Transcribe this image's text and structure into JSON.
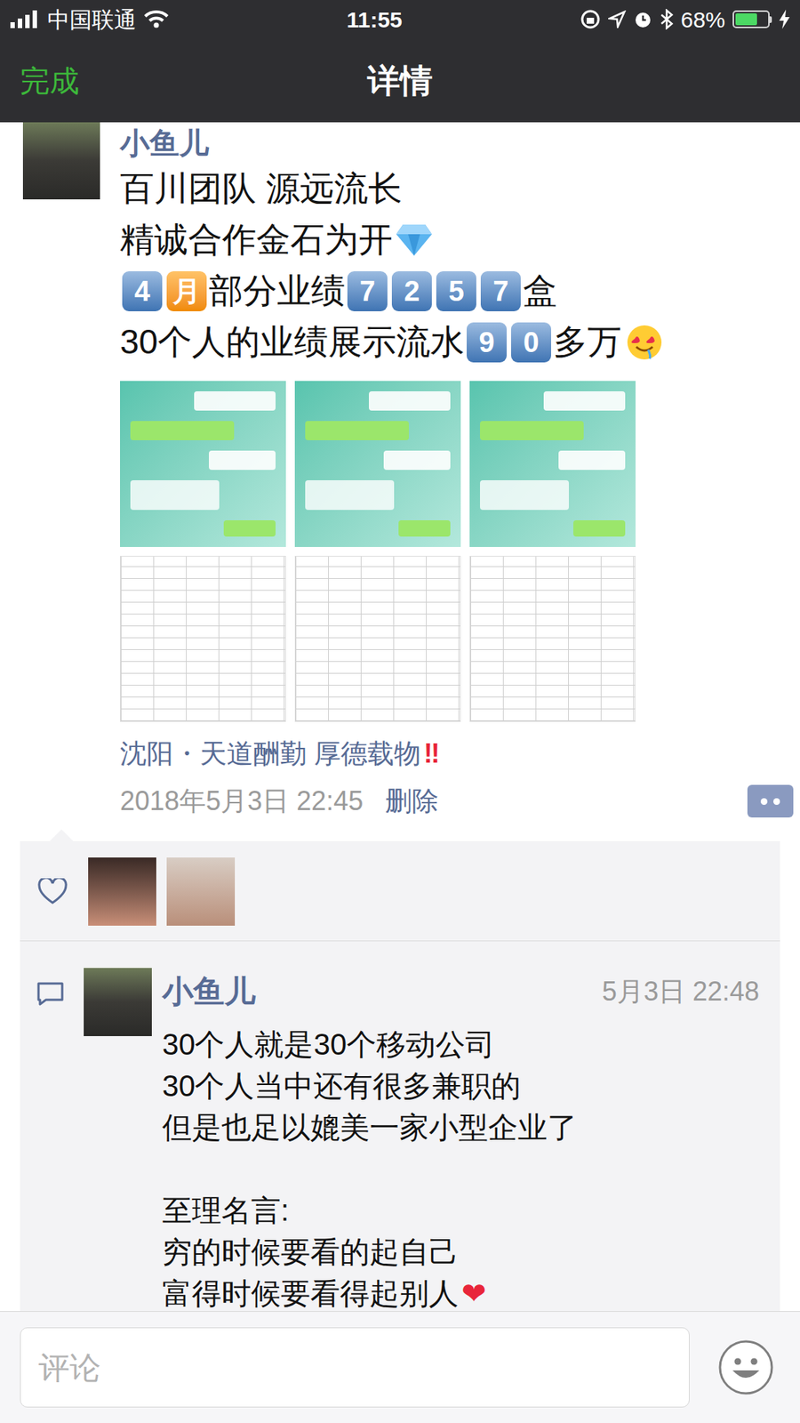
{
  "status_bar": {
    "carrier": "中国联通",
    "time": "11:55",
    "battery": {
      "reading": "68%",
      "level": 0.68,
      "charging": true
    }
  },
  "nav": {
    "done": "完成",
    "title": "详情"
  },
  "post": {
    "author": "小鱼儿",
    "lines": [
      [
        {
          "kind": "text",
          "text": "百川团队 源远流长"
        }
      ],
      [
        {
          "kind": "text",
          "text": "精诚合作金石为开"
        },
        {
          "kind": "diamond"
        }
      ],
      [
        {
          "kind": "keycap",
          "text": "4"
        },
        {
          "kind": "keycap-orange",
          "text": "月"
        },
        {
          "kind": "text",
          "text": "部分业绩"
        },
        {
          "kind": "keycap",
          "text": "7"
        },
        {
          "kind": "keycap",
          "text": "2"
        },
        {
          "kind": "keycap",
          "text": "5"
        },
        {
          "kind": "keycap",
          "text": "7"
        },
        {
          "kind": "text",
          "text": "盒"
        }
      ],
      [
        {
          "kind": "text",
          "text": "30个人的业绩展示流水"
        },
        {
          "kind": "keycap",
          "text": "9"
        },
        {
          "kind": "keycap",
          "text": "0"
        },
        {
          "kind": "text",
          "text": "多万"
        },
        {
          "kind": "face"
        }
      ]
    ],
    "images": [
      {
        "kind": "chat"
      },
      {
        "kind": "chat"
      },
      {
        "kind": "chat"
      },
      {
        "kind": "table"
      },
      {
        "kind": "table"
      },
      {
        "kind": "table"
      }
    ],
    "location": {
      "text": "沈阳・天道酬勤 厚德载物",
      "mark": "‼"
    },
    "time": "2018年5月3日 22:45",
    "delete": "删除"
  },
  "likes": [
    {
      "kind": "photo"
    },
    {
      "kind": "photo"
    }
  ],
  "comments": [
    {
      "author": "小鱼儿",
      "time": "5月3日 22:48",
      "lines": [
        "30个人就是30个移动公司",
        "30个人当中还有很多兼职的",
        "但是也足以媲美一家小型企业了",
        "",
        "至理名言:",
        "穷的时候要看的起自己",
        "富得时候要看得起别人"
      ],
      "mark": "❤"
    }
  ],
  "input": {
    "placeholder": "评论"
  }
}
